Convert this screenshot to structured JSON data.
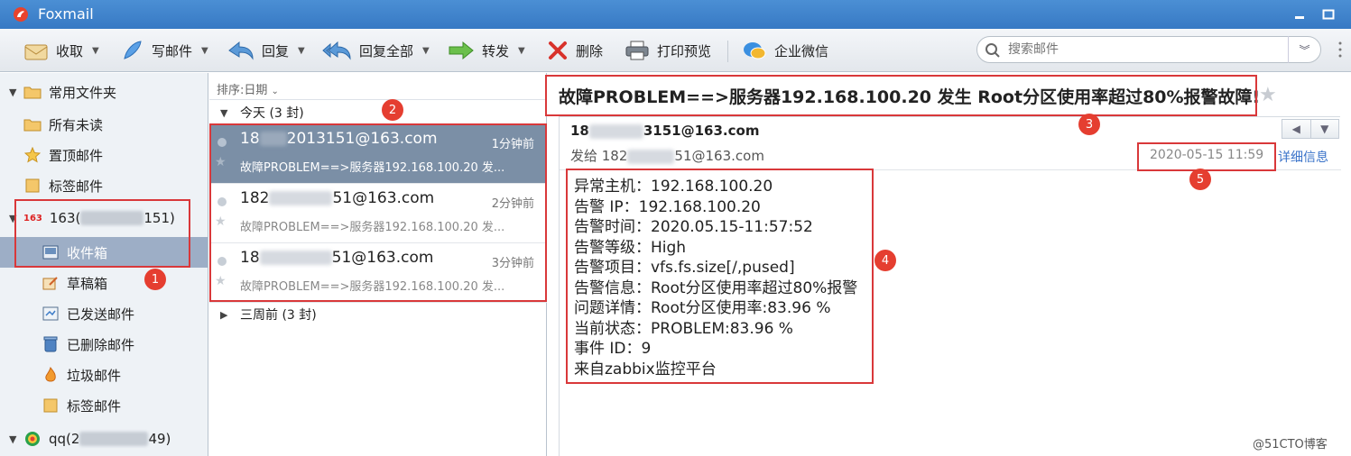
{
  "window": {
    "title": "Foxmail"
  },
  "toolbar": {
    "receive": "收取",
    "compose": "写邮件",
    "reply": "回复",
    "reply_all": "回复全部",
    "forward": "转发",
    "delete": "删除",
    "print_preview": "打印预览",
    "wecom": "企业微信"
  },
  "search": {
    "placeholder": "搜索邮件"
  },
  "sidebar": {
    "common_folder": "常用文件夹",
    "unread": "所有未读",
    "pinned": "置顶邮件",
    "tagged": "标签邮件",
    "account1_prefix": "163(",
    "account1_suffix": "151)",
    "account1_icon_text": "163",
    "inbox": "收件箱",
    "drafts": "草稿箱",
    "sent": "已发送邮件",
    "deleted": "已删除邮件",
    "junk": "垃圾邮件",
    "tagged2": "标签邮件",
    "account2_prefix": "qq(2",
    "account2_suffix": "49)"
  },
  "list": {
    "sort_label": "排序:日期",
    "today_group": "今天 (3 封)",
    "weeks_group": "三周前 (3 封)",
    "mails": [
      {
        "from_a": "18",
        "from_b": "2013151@163.com",
        "time": "1分钟前",
        "subject": "故障PROBLEM==>服务器192.168.100.20 发..."
      },
      {
        "from_a": "182",
        "from_b": "51@163.com",
        "time": "2分钟前",
        "subject": "故障PROBLEM==>服务器192.168.100.20 发..."
      },
      {
        "from_a": "18",
        "from_b": "51@163.com",
        "time": "3分钟前",
        "subject": "故障PROBLEM==>服务器192.168.100.20 发..."
      }
    ]
  },
  "reader": {
    "title": "故障PROBLEM==>服务器192.168.100.20 发生 Root分区使用率超过80%报警故障!",
    "sender_a": "18",
    "sender_b": "3151@163.com",
    "to_a": "发给 182",
    "to_b": "51@163.com",
    "date": "2020-05-15 11:59",
    "detail_link": "详细信息",
    "body": [
      "异常主机：192.168.100.20",
      "告警 IP：192.168.100.20",
      "告警时间：2020.05.15-11:57:52",
      "告警等级：High",
      "告警项目：vfs.fs.size[/,pused]",
      "告警信息：Root分区使用率超过80%报警",
      "问题详情：Root分区使用率:83.96 %",
      "当前状态：PROBLEM:83.96 %",
      "事件 ID：9",
      "来自zabbix监控平台"
    ]
  },
  "annotations": [
    "1",
    "2",
    "3",
    "4",
    "5"
  ],
  "watermark": "@51CTO博客",
  "colors": {
    "titlebar": "#3d82cb",
    "selection": "#9daec6",
    "annotation": "#d9383a"
  }
}
